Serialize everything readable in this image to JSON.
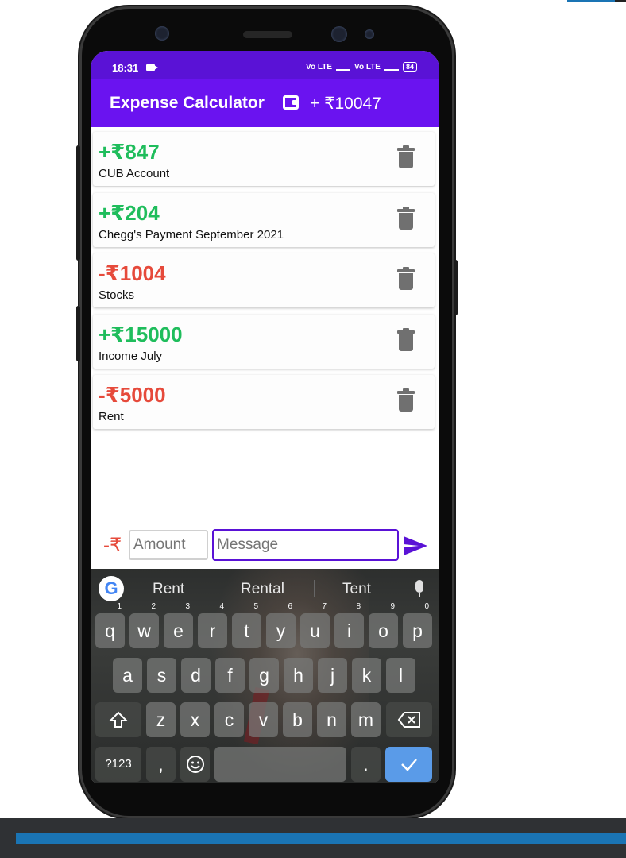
{
  "status_bar": {
    "time": "18:31",
    "signal_1": "Vo LTE",
    "signal_2": "Vo LTE",
    "battery": "84"
  },
  "app_bar": {
    "title": "Expense Calculator",
    "balance": "+ ₹10047"
  },
  "transactions": [
    {
      "amount": "+₹847",
      "description": "CUB Account",
      "type": "income"
    },
    {
      "amount": "+₹204",
      "description": "Chegg's Payment September 2021",
      "type": "income"
    },
    {
      "amount": "-₹1004",
      "description": "Stocks",
      "type": "expense"
    },
    {
      "amount": "+₹15000",
      "description": "Income July",
      "type": "income"
    },
    {
      "amount": "-₹5000",
      "description": "Rent",
      "type": "expense"
    }
  ],
  "input": {
    "sign": "-₹",
    "amount_placeholder": "Amount",
    "message_placeholder": "Message"
  },
  "keyboard": {
    "suggestions": [
      "Rent",
      "Rental",
      "Tent"
    ],
    "row1": [
      "q",
      "w",
      "e",
      "r",
      "t",
      "y",
      "u",
      "i",
      "o",
      "p"
    ],
    "row1_hints": [
      "1",
      "2",
      "3",
      "4",
      "5",
      "6",
      "7",
      "8",
      "9",
      "0"
    ],
    "row2": [
      "a",
      "s",
      "d",
      "f",
      "g",
      "h",
      "j",
      "k",
      "l"
    ],
    "row3": [
      "z",
      "x",
      "c",
      "v",
      "b",
      "n",
      "m"
    ],
    "symbols_key": "?123",
    "comma_key": ",",
    "period_key": "."
  },
  "colors": {
    "income": "#1fbd5c",
    "expense": "#e64a3b",
    "accent": "#6a13f0",
    "status_bar": "#5a12d6"
  }
}
